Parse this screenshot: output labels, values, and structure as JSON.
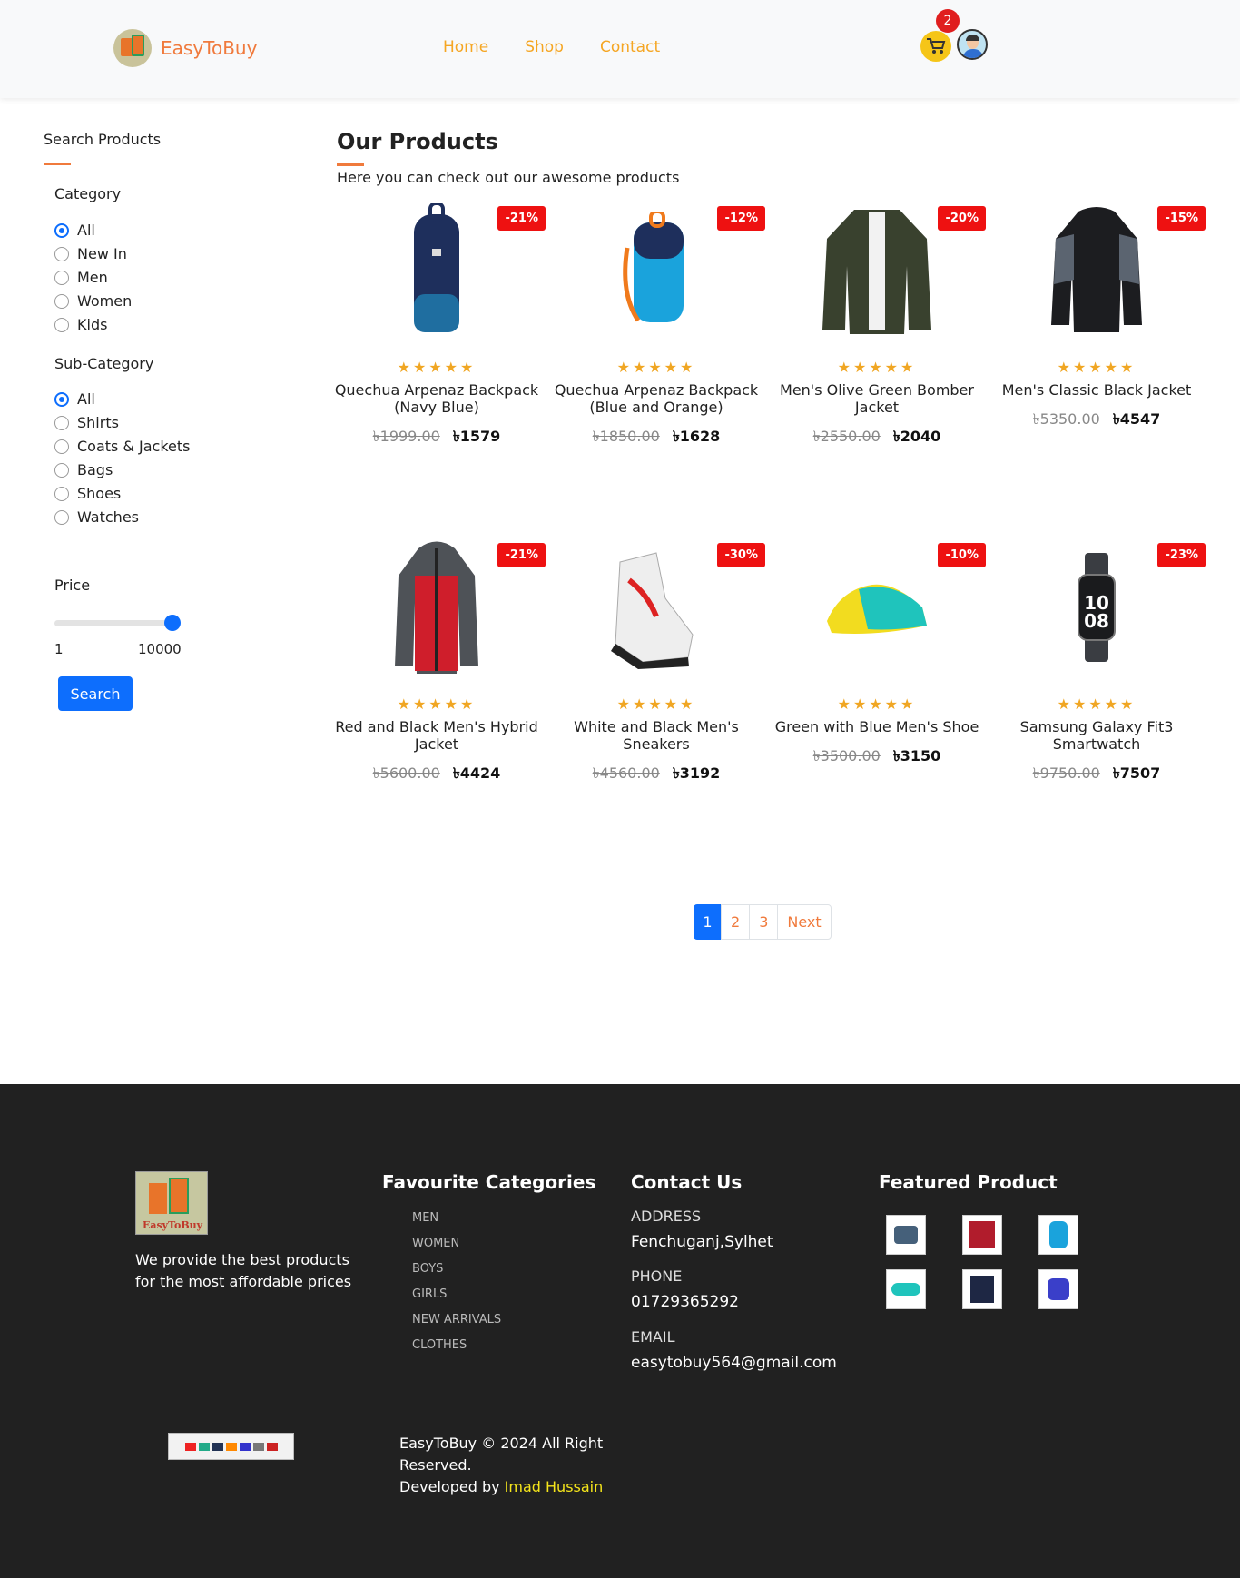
{
  "header": {
    "brand": "EasyToBuy",
    "nav": [
      "Home",
      "Shop",
      "Contact"
    ],
    "cart_count": "2"
  },
  "sidebar": {
    "title": "Search Products",
    "category_title": "Category",
    "categories": [
      "All",
      "New In",
      "Men",
      "Women",
      "Kids"
    ],
    "subcategory_title": "Sub-Category",
    "subcategories": [
      "All",
      "Shirts",
      "Coats & Jackets",
      "Bags",
      "Shoes",
      "Watches"
    ],
    "price_title": "Price",
    "price_min": "1",
    "price_max": "10000",
    "price_slider_fraction": 1.0,
    "search_label": "Search"
  },
  "main": {
    "title": "Our Products",
    "subtitle": "Here you can check out our awesome products"
  },
  "products": [
    {
      "discount": "-21%",
      "stars": "★★★★★",
      "name": "Quechua Arpenaz Backpack (Navy Blue)",
      "old": "৳1999.00",
      "new": "৳1579",
      "icon": "backpack-navy-icon"
    },
    {
      "discount": "-12%",
      "stars": "★★★★★",
      "name": "Quechua Arpenaz Backpack (Blue and Orange)",
      "old": "৳1850.00",
      "new": "৳1628",
      "icon": "backpack-blue-icon"
    },
    {
      "discount": "-20%",
      "stars": "★★★★★",
      "name": "Men's Olive Green Bomber Jacket",
      "old": "৳2550.00",
      "new": "৳2040",
      "icon": "jacket-green-icon"
    },
    {
      "discount": "-15%",
      "stars": "★★★★★",
      "name": "Men's Classic Black Jacket",
      "old": "৳5350.00",
      "new": "৳4547",
      "icon": "jacket-black-icon"
    },
    {
      "discount": "-21%",
      "stars": "★★★★★",
      "name": "Red and Black Men's Hybrid Jacket",
      "old": "৳5600.00",
      "new": "৳4424",
      "icon": "jacket-red-icon"
    },
    {
      "discount": "-30%",
      "stars": "★★★★★",
      "name": "White and Black Men's Sneakers",
      "old": "৳4560.00",
      "new": "৳3192",
      "icon": "sneaker-white-icon"
    },
    {
      "discount": "-10%",
      "stars": "★★★★★",
      "name": "Green with Blue Men's Shoe",
      "old": "৳3500.00",
      "new": "৳3150",
      "icon": "shoe-green-icon"
    },
    {
      "discount": "-23%",
      "stars": "★★★★★",
      "name": "Samsung Galaxy Fit3 Smartwatch",
      "old": "৳9750.00",
      "new": "৳7507",
      "icon": "smartwatch-icon"
    }
  ],
  "pagination": [
    "1",
    "2",
    "3",
    "Next"
  ],
  "footer": {
    "logo_text": "EasyToBuy",
    "tagline": "We provide the best products for the most affordable prices",
    "fav_title": "Favourite Categories",
    "fav_items": [
      "MEN",
      "WOMEN",
      "BOYS",
      "GIRLS",
      "NEW ARRIVALS",
      "CLOTHES"
    ],
    "contact_title": "Contact Us",
    "address_label": "ADDRESS",
    "address": "Fenchuganj,Sylhet",
    "phone_label": "PHONE",
    "phone": "01729365292",
    "email_label": "EMAIL",
    "email": "easytobuy564@gmail.com",
    "featured_title": "Featured Product",
    "copyright": "EasyToBuy © 2024 All Right Reserved.",
    "developed_by": "Developed by",
    "developer": "Imad Hussain"
  }
}
